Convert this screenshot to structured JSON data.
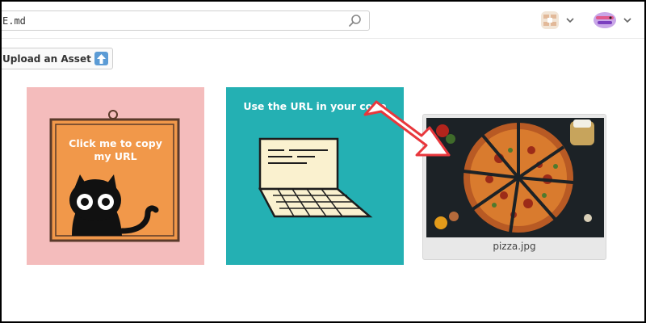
{
  "search": {
    "value": "E.md"
  },
  "toolbar": {
    "upload_label": "Upload an Asset"
  },
  "tiles": [
    {
      "caption": "Click me to copy\nmy URL"
    },
    {
      "caption": "Use the URL in your code"
    }
  ],
  "asset": {
    "filename": "pizza.jpg"
  },
  "icons": [
    "search-icon",
    "chevron-down-icon",
    "upload-arrow-icon",
    "pointer-arrow-icon"
  ],
  "colors": {
    "pink_tile": "#f4bcbc",
    "teal_tile": "#24b0b3",
    "frame_orange": "#f1984a",
    "arrow_red": "#e8373c"
  }
}
